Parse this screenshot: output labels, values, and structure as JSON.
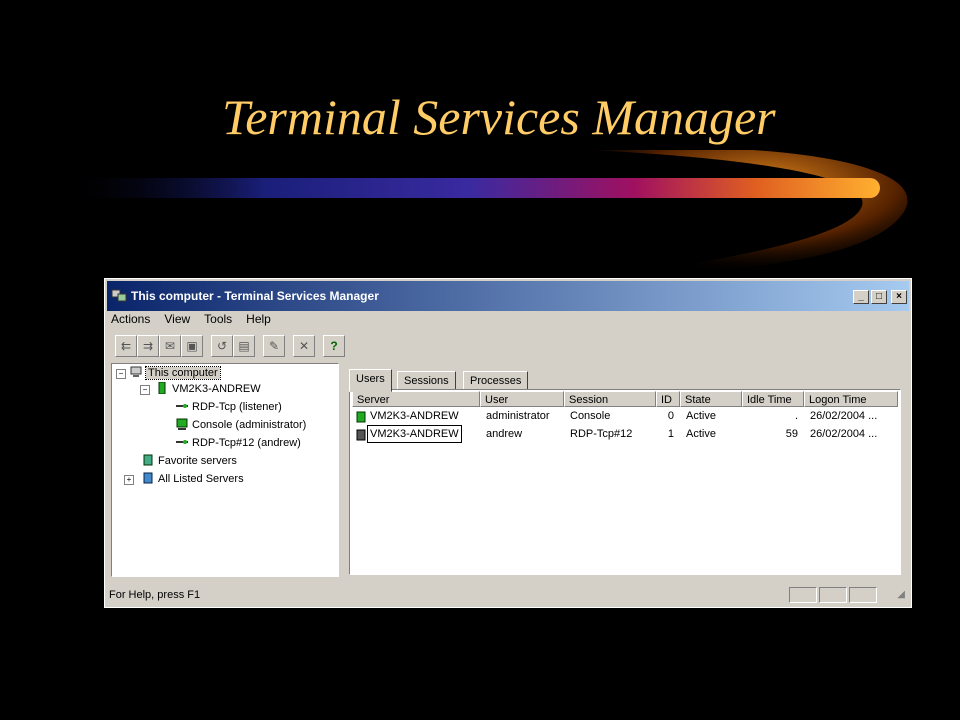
{
  "slide": {
    "title": "Terminal Services Manager"
  },
  "window": {
    "title": "This computer - Terminal Services Manager",
    "controls": {
      "minimize": "_",
      "maximize": "□",
      "close": "×"
    }
  },
  "menu": [
    "Actions",
    "View",
    "Tools",
    "Help"
  ],
  "tree": {
    "root": "This computer",
    "server": "VM2K3-ANDREW",
    "sessions": [
      "RDP-Tcp (listener)",
      "Console (administrator)",
      "RDP-Tcp#12 (andrew)"
    ],
    "favorites": "Favorite servers",
    "all_listed": "All Listed Servers"
  },
  "tabs": [
    "Users",
    "Sessions",
    "Processes"
  ],
  "table": {
    "columns": [
      "Server",
      "User",
      "Session",
      "ID",
      "State",
      "Idle Time",
      "Logon Time"
    ],
    "rows": [
      [
        "VM2K3-ANDREW",
        "administrator",
        "Console",
        "0",
        "Active",
        ".",
        "26/02/2004 ..."
      ],
      [
        "VM2K3-ANDREW",
        "andrew",
        "RDP-Tcp#12",
        "1",
        "Active",
        "59",
        "26/02/2004 ..."
      ]
    ]
  },
  "status": {
    "text": "For Help, press F1"
  },
  "colors": {
    "title_text": "#ffcc66",
    "titlebar_start": "#0a246a",
    "titlebar_end": "#a6caf0"
  }
}
